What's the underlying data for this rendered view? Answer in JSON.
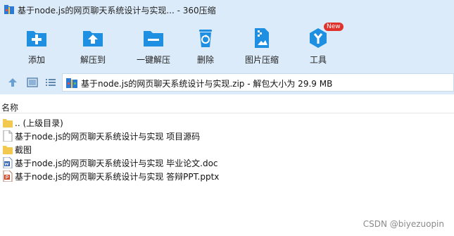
{
  "window": {
    "title": "基于node.js的网页聊天系统设计与实现... - 360压缩"
  },
  "toolbar": {
    "items": [
      {
        "label": "添加",
        "icon": "add-archive-icon"
      },
      {
        "label": "解压到",
        "icon": "extract-to-icon"
      },
      {
        "label": "一键解压",
        "icon": "one-click-extract-icon"
      },
      {
        "label": "删除",
        "icon": "recycle-delete-icon"
      },
      {
        "label": "图片压缩",
        "icon": "image-compress-icon"
      },
      {
        "label": "工具",
        "icon": "tools-icon",
        "badge": "New"
      }
    ]
  },
  "address": {
    "text": "基于node.js的网页聊天系统设计与实现.zip - 解包大小为 29.9 MB"
  },
  "columns": {
    "name": "名称"
  },
  "files": [
    {
      "name": ".. (上级目录)",
      "type": "folder"
    },
    {
      "name": "基于node.js的网页聊天系统设计与实现 项目源码",
      "type": "file"
    },
    {
      "name": "截图",
      "type": "folder"
    },
    {
      "name": "基于node.js的网页聊天系统设计与实现 毕业论文.doc",
      "type": "word"
    },
    {
      "name": "基于node.js的网页聊天系统设计与实现 答辩PPT.pptx",
      "type": "ppt"
    }
  ],
  "watermark": "CSDN @biyezuopin",
  "colors": {
    "toolbar_bg": "#dcebf9",
    "icon_blue": "#1e8fe1",
    "badge_red": "#e0312b"
  }
}
